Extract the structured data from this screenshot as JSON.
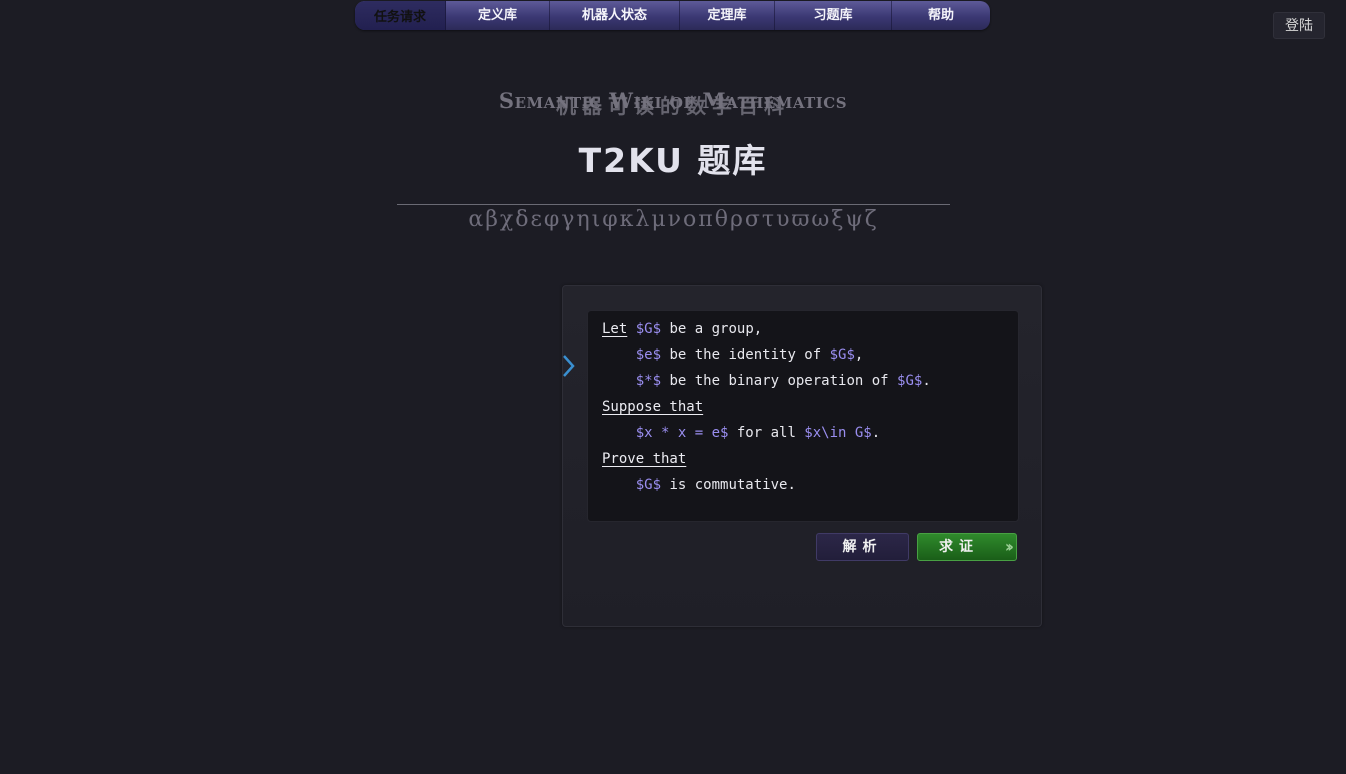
{
  "nav": {
    "items": [
      {
        "label": "任务请求",
        "active": true
      },
      {
        "label": "定义库"
      },
      {
        "label": "机器人状态"
      },
      {
        "label": "定理库"
      },
      {
        "label": "习题库"
      },
      {
        "label": "帮助"
      }
    ]
  },
  "login": {
    "label": "登陆"
  },
  "header": {
    "subtitle_en": "Semantic Wiki of Mathematics",
    "subtitle_zh": "机器可读的数学百科",
    "title": "T2KU 题库",
    "greek": "αβχδεφγηιφκλμνοπθρστυϖωξψζ"
  },
  "problem": {
    "lines": [
      {
        "kw": "Let",
        "parts": [
          " ",
          {
            "m": "$G$"
          },
          " be a group,"
        ]
      },
      {
        "indent": true,
        "parts": [
          {
            "m": "$e$"
          },
          " be the identity of ",
          {
            "m": "$G$"
          },
          ","
        ]
      },
      {
        "indent": true,
        "parts": [
          {
            "m": "$*$"
          },
          " be the binary operation of ",
          {
            "m": "$G$"
          },
          "."
        ]
      },
      {
        "kw": "Suppose that",
        "parts": []
      },
      {
        "indent": true,
        "parts": [
          {
            "m": "$x * x = e$"
          },
          " for all ",
          {
            "m": "$x\\in G$"
          },
          "."
        ]
      },
      {
        "kw": "Prove that",
        "parts": []
      },
      {
        "indent": true,
        "parts": [
          {
            "m": "$G$"
          },
          " is commutative."
        ]
      }
    ]
  },
  "actions": {
    "parse_label": "解析",
    "prove_label": "求证",
    "prove_icon": "double-chevron-right-icon"
  },
  "colors": {
    "background": "#1c1c24",
    "nav_accent": "#3b3873",
    "math_text": "#9a8ef0",
    "prove_button": "#2f8a2c",
    "parse_button": "#2c2748"
  }
}
